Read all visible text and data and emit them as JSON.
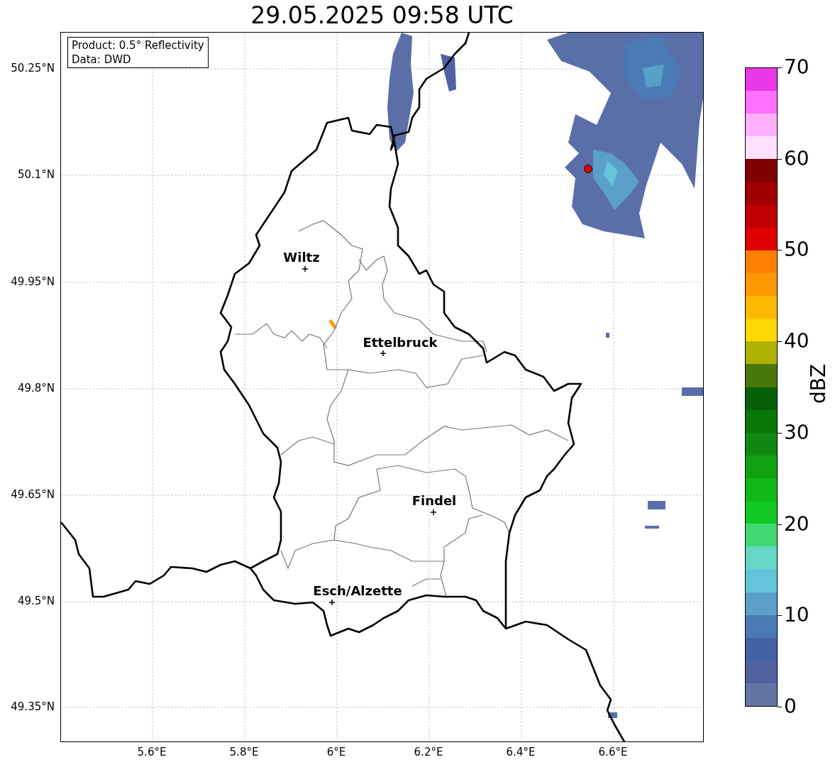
{
  "title": "29.05.2025 09:58 UTC",
  "info_box": [
    "Product: 0.5° Reflectivity",
    "Data: DWD"
  ],
  "map": {
    "y_ticks": [
      "50.25°N",
      "50.1°N",
      "49.95°N",
      "49.8°N",
      "49.65°N",
      "49.5°N",
      "49.35°N"
    ],
    "x_ticks": [
      "5.6°E",
      "5.8°E",
      "6°E",
      "6.2°E",
      "6.4°E",
      "6.6°E"
    ],
    "cities": [
      {
        "name": "Wiltz"
      },
      {
        "name": "Ettelbruck"
      },
      {
        "name": "Findel"
      },
      {
        "name": "Esch/Alzette"
      }
    ]
  },
  "colorbar": {
    "label": "dBZ",
    "ticks": [
      "70",
      "60",
      "50",
      "40",
      "30",
      "20",
      "10",
      "0"
    ]
  }
}
